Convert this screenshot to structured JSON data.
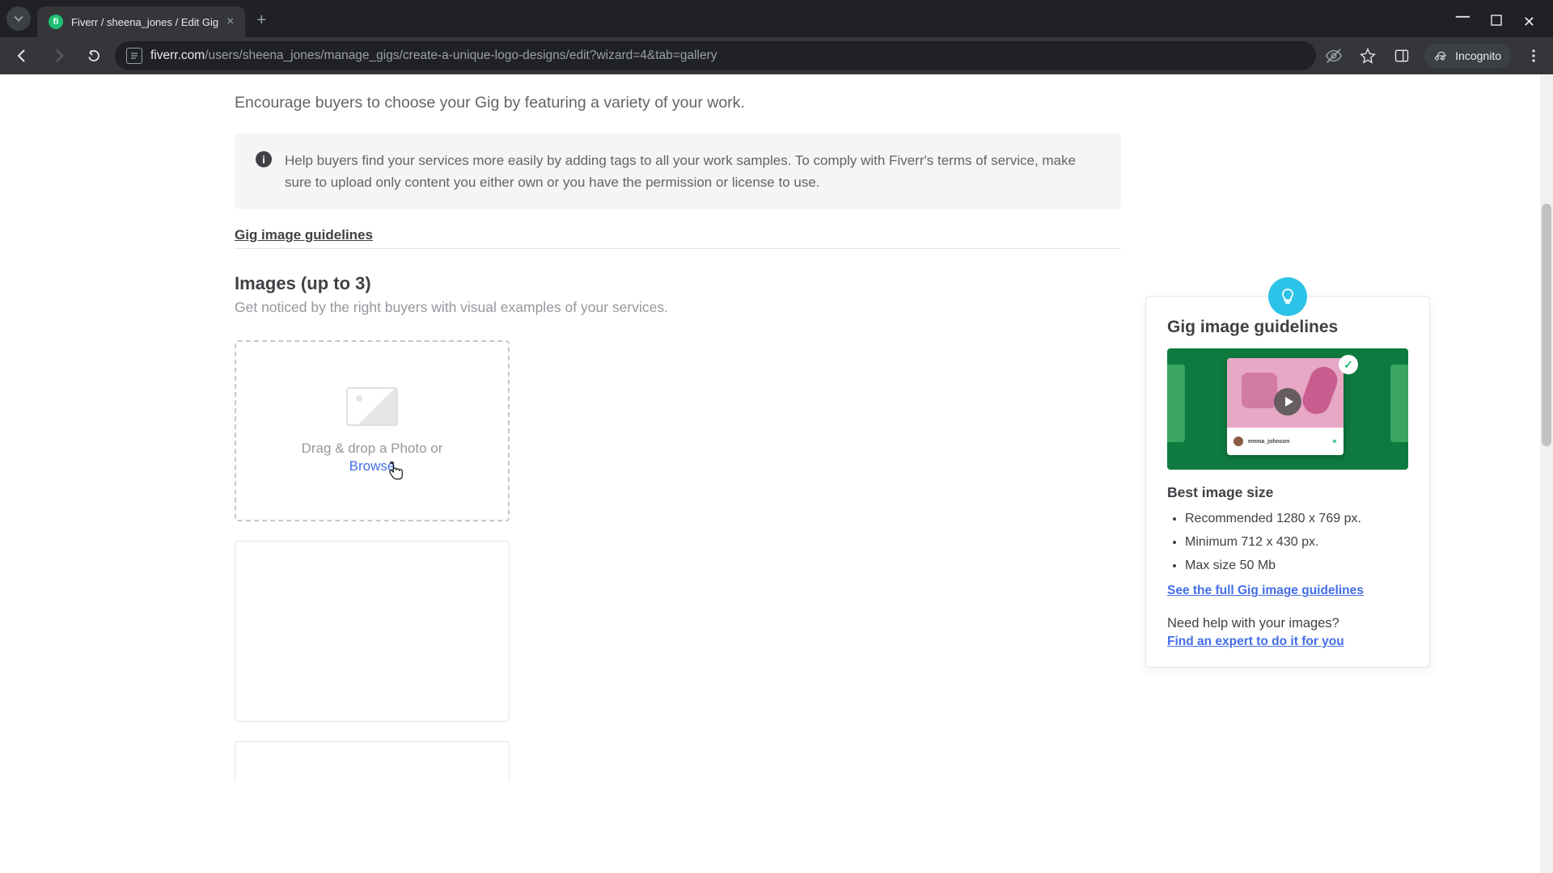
{
  "browser": {
    "tab_title": "Fiverr / sheena_jones / Edit Gig",
    "url_host": "fiverr.com",
    "url_path": "/users/sheena_jones/manage_gigs/create-a-unique-logo-designs/edit?wizard=4&tab=gallery",
    "incognito_label": "Incognito"
  },
  "page": {
    "lead": "Encourage buyers to choose your Gig by featuring a variety of your work.",
    "info": "Help buyers find your services more easily by adding tags to all your work samples. To comply with Fiverr's terms of service, make sure to upload only content you either own or you have the permission or license to use.",
    "guidelines_link": "Gig image guidelines",
    "images_heading": "Images (up to 3)",
    "images_sub": "Get noticed by the right buyers with visual examples of your services.",
    "upload_text": "Drag & drop a Photo or",
    "upload_browse": "Browse"
  },
  "tip": {
    "title": "Gig image guidelines",
    "preview_name": "emma_johnson",
    "size_heading": "Best image size",
    "bullets": [
      "Recommended 1280 x 769 px.",
      "Minimum 712 x 430 px.",
      "Max size 50 Mb"
    ],
    "full_link": "See the full Gig image guidelines",
    "need_help": "Need help with your images?",
    "expert_link": "Find an expert to do it for you"
  }
}
